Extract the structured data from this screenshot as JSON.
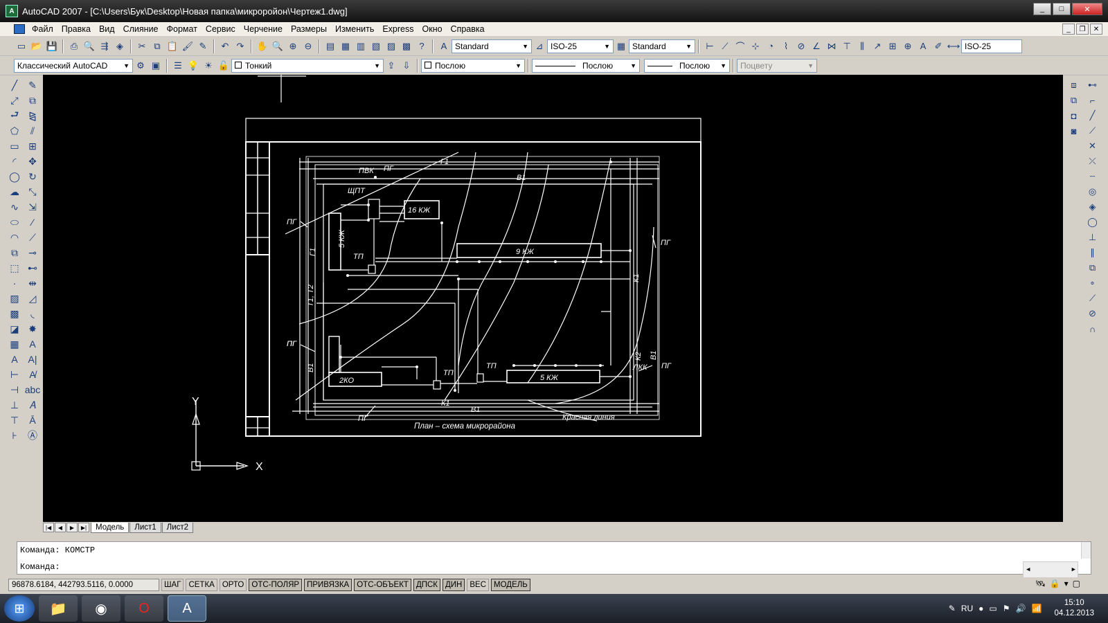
{
  "window": {
    "title": "AutoCAD 2007 - [C:\\Users\\Бук\\Desktop\\Новая папка\\микроройон\\Чертеж1.dwg]",
    "minimize": "_",
    "maximize": "□",
    "close": "✕"
  },
  "menu": [
    "Файл",
    "Правка",
    "Вид",
    "Слияние",
    "Формат",
    "Сервис",
    "Черчение",
    "Размеры",
    "Изменить",
    "Express",
    "Окно",
    "Справка"
  ],
  "styles_toolbar": {
    "text_style": "Standard",
    "dim_style": "ISO-25",
    "table_style": "Standard",
    "dim_style_right": "ISO-25"
  },
  "layers_toolbar": {
    "workspace": "Классический AutoCAD",
    "layer": "Тонкий",
    "color": "Послою",
    "linetype": "Послою",
    "lineweight": "Послою",
    "plotstyle": "Поцвету"
  },
  "drawing": {
    "caption": "План – схема микрорайона",
    "red_line_label": "Красная линия",
    "labels": [
      "ПВК",
      "ПГ",
      "ЩПТ",
      "Г1",
      "16 КЖ",
      "В1",
      "ПГ",
      "ПГ",
      "Г1",
      "5 КЖ",
      "ТП",
      "9 КЖ",
      "ПГ",
      "Т1, Т2",
      "К1",
      "ПГ",
      "В1",
      "2КО",
      "ТП",
      "ТП",
      "5 КЖ",
      "ЛКК",
      "К2",
      "В1",
      "ПГ",
      "ПГ",
      "К1",
      "В1"
    ],
    "ucs": {
      "x": "X",
      "y": "Y"
    }
  },
  "tabs": [
    "Модель",
    "Лист1",
    "Лист2"
  ],
  "active_tab": "Модель",
  "command": {
    "history": "Команда:  КОМСТР",
    "prompt": "Команда:"
  },
  "status": {
    "coords": "96878.6184, 442793.5116, 0.0000",
    "toggles": [
      "ШАГ",
      "СЕТКА",
      "ОРТО",
      "ОТС-ПОЛЯР",
      "ПРИВЯЗКА",
      "ОТС-ОБЪЕКТ",
      "ДПСК",
      "ДИН",
      "ВЕС",
      "МОДЕЛЬ"
    ],
    "on": [
      "ОТС-ПОЛЯР",
      "ПРИВЯЗКА",
      "ОТС-ОБЪЕКТ",
      "ДПСК",
      "ДИН",
      "МОДЕЛЬ"
    ]
  },
  "taskbar": {
    "lang": "RU",
    "time": "15:10",
    "date": "04.12.2013"
  },
  "colors": {
    "canvas": "#000000",
    "lines": "#ffffff"
  }
}
